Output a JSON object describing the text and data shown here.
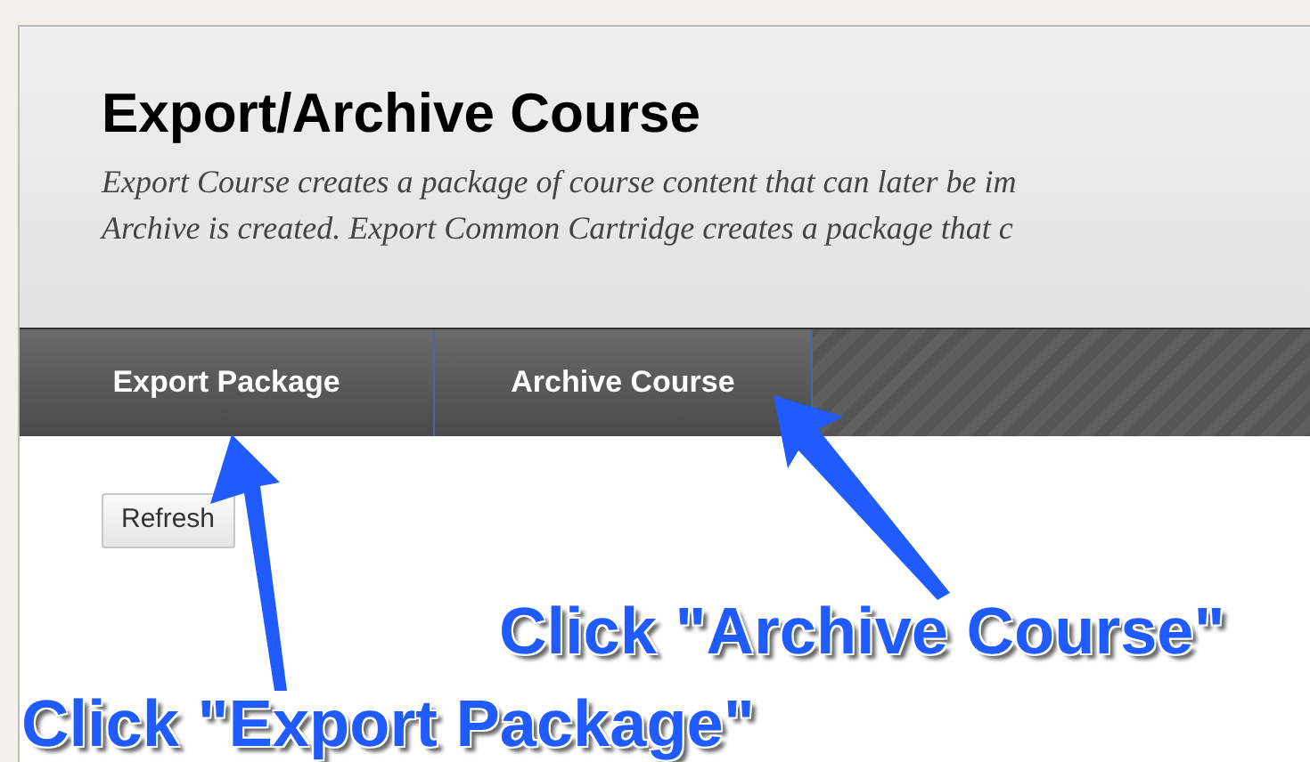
{
  "header": {
    "title": "Export/Archive Course",
    "description_lines": [
      "Export Course creates a package of course content that can later be im",
      "Archive is created. Export Common Cartridge creates a package that c"
    ]
  },
  "tabs": [
    {
      "label": "Export Package"
    },
    {
      "label": "Archive Course"
    }
  ],
  "buttons": [
    "Refresh"
  ],
  "annotations": [
    {
      "text": "Click \"Archive Course\""
    },
    {
      "text": "Click \"Export Package\""
    }
  ]
}
